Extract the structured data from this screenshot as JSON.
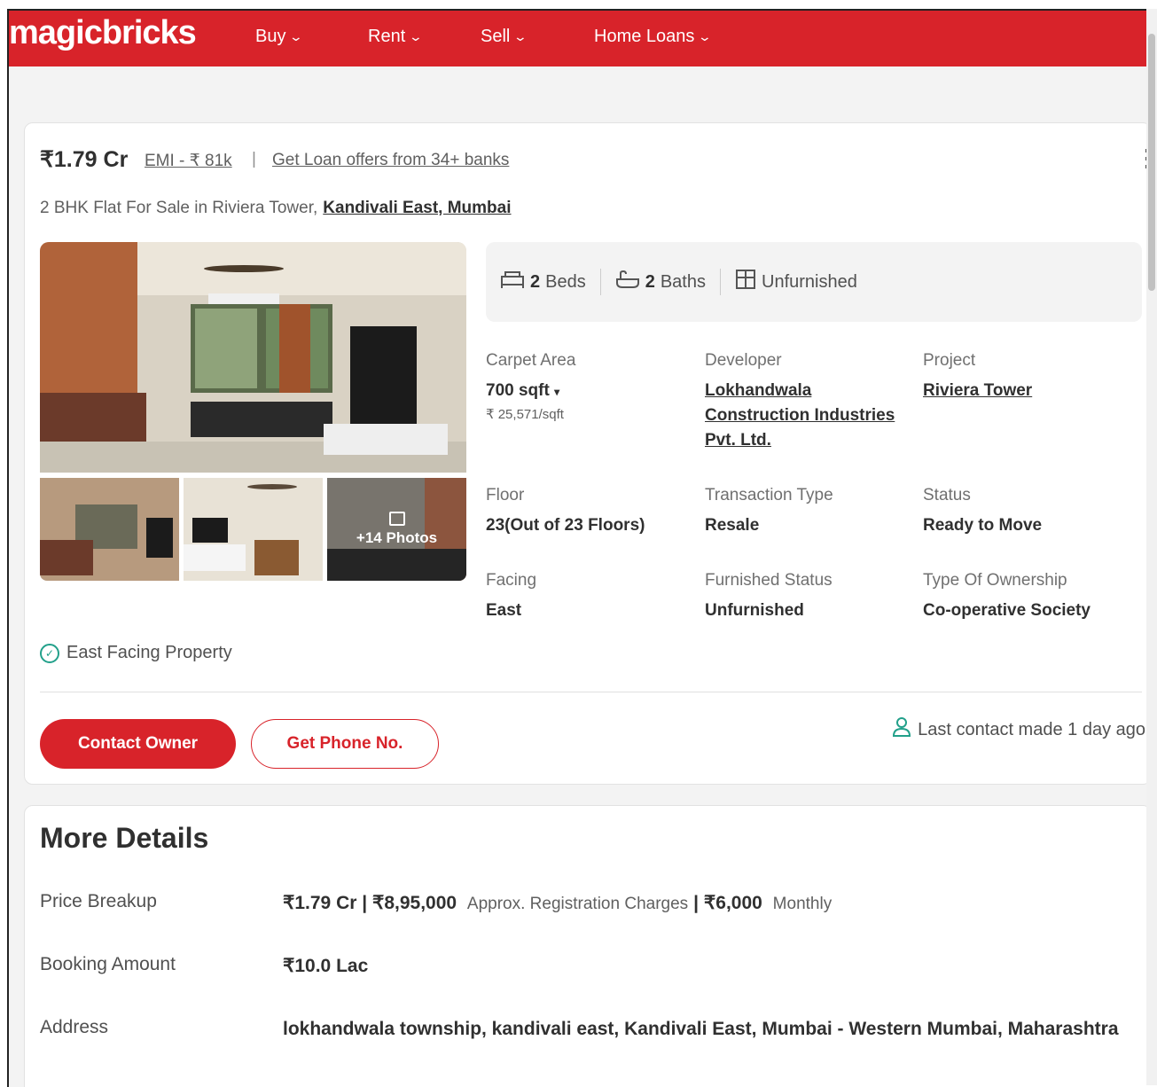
{
  "nav": {
    "logo": "magicbricks",
    "items": [
      "Buy",
      "Rent",
      "Sell",
      "Home Loans"
    ]
  },
  "listing": {
    "price": "₹1.79 Cr",
    "emi": "EMI - ₹ 81k",
    "separator": "|",
    "loan_offer": "Get Loan offers from 34+ banks",
    "title": "2 BHK Flat For Sale in Riviera Tower,",
    "locality": "Kandivali East, Mumbai",
    "photos_more": "+14 Photos",
    "summary": {
      "beds_num": "2",
      "beds_label": "Beds",
      "baths_num": "2",
      "baths_label": "Baths",
      "furnishing": "Unfurnished"
    },
    "attributes": {
      "carpet_area_label": "Carpet Area",
      "carpet_area_value": "700 sqft",
      "carpet_area_rate": "₹ 25,571/sqft",
      "developer_label": "Developer",
      "developer_value": "Lokhandwala Construction Industries Pvt. Ltd.",
      "project_label": "Project",
      "project_value": "Riviera Tower",
      "floor_label": "Floor",
      "floor_value": "23(Out of 23 Floors)",
      "transaction_label": "Transaction Type",
      "transaction_value": "Resale",
      "status_label": "Status",
      "status_value": "Ready to Move",
      "facing_label": "Facing",
      "facing_value": "East",
      "furnished_label": "Furnished Status",
      "furnished_value": "Unfurnished",
      "ownership_label": "Type Of Ownership",
      "ownership_value": "Co-operative Society"
    },
    "highlight": "East Facing Property",
    "contact_owner": "Contact Owner",
    "get_phone": "Get Phone No.",
    "last_contact": "Last contact made 1 day ago"
  },
  "more_details": {
    "title": "More Details",
    "price_breakup_label": "Price Breakup",
    "price_main": "₹1.79 Cr |",
    "registration": "₹8,95,000",
    "registration_note": "Approx. Registration Charges",
    "pipe": "|",
    "monthly": "₹6,000",
    "monthly_note": "Monthly",
    "booking_label": "Booking Amount",
    "booking_value": "₹10.0 Lac",
    "address_label": "Address",
    "address_value": "lokhandwala township, kandivali east, Kandivali East, Mumbai - Western Mumbai, Maharashtra"
  },
  "colors": {
    "brand": "#d8232a",
    "accent_green": "#22a08a"
  }
}
